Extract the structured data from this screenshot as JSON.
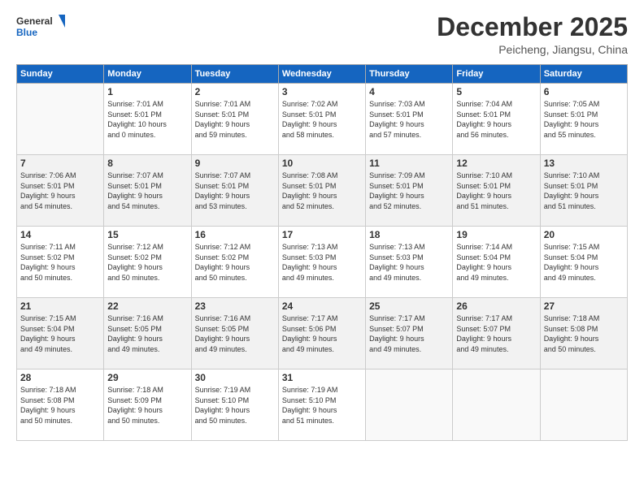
{
  "logo": {
    "line1": "General",
    "line2": "Blue"
  },
  "title": "December 2025",
  "subtitle": "Peicheng, Jiangsu, China",
  "weekdays": [
    "Sunday",
    "Monday",
    "Tuesday",
    "Wednesday",
    "Thursday",
    "Friday",
    "Saturday"
  ],
  "weeks": [
    [
      {
        "day": "",
        "content": ""
      },
      {
        "day": "1",
        "content": "Sunrise: 7:01 AM\nSunset: 5:01 PM\nDaylight: 10 hours\nand 0 minutes."
      },
      {
        "day": "2",
        "content": "Sunrise: 7:01 AM\nSunset: 5:01 PM\nDaylight: 9 hours\nand 59 minutes."
      },
      {
        "day": "3",
        "content": "Sunrise: 7:02 AM\nSunset: 5:01 PM\nDaylight: 9 hours\nand 58 minutes."
      },
      {
        "day": "4",
        "content": "Sunrise: 7:03 AM\nSunset: 5:01 PM\nDaylight: 9 hours\nand 57 minutes."
      },
      {
        "day": "5",
        "content": "Sunrise: 7:04 AM\nSunset: 5:01 PM\nDaylight: 9 hours\nand 56 minutes."
      },
      {
        "day": "6",
        "content": "Sunrise: 7:05 AM\nSunset: 5:01 PM\nDaylight: 9 hours\nand 55 minutes."
      }
    ],
    [
      {
        "day": "7",
        "content": "Sunrise: 7:06 AM\nSunset: 5:01 PM\nDaylight: 9 hours\nand 54 minutes."
      },
      {
        "day": "8",
        "content": "Sunrise: 7:07 AM\nSunset: 5:01 PM\nDaylight: 9 hours\nand 54 minutes."
      },
      {
        "day": "9",
        "content": "Sunrise: 7:07 AM\nSunset: 5:01 PM\nDaylight: 9 hours\nand 53 minutes."
      },
      {
        "day": "10",
        "content": "Sunrise: 7:08 AM\nSunset: 5:01 PM\nDaylight: 9 hours\nand 52 minutes."
      },
      {
        "day": "11",
        "content": "Sunrise: 7:09 AM\nSunset: 5:01 PM\nDaylight: 9 hours\nand 52 minutes."
      },
      {
        "day": "12",
        "content": "Sunrise: 7:10 AM\nSunset: 5:01 PM\nDaylight: 9 hours\nand 51 minutes."
      },
      {
        "day": "13",
        "content": "Sunrise: 7:10 AM\nSunset: 5:01 PM\nDaylight: 9 hours\nand 51 minutes."
      }
    ],
    [
      {
        "day": "14",
        "content": "Sunrise: 7:11 AM\nSunset: 5:02 PM\nDaylight: 9 hours\nand 50 minutes."
      },
      {
        "day": "15",
        "content": "Sunrise: 7:12 AM\nSunset: 5:02 PM\nDaylight: 9 hours\nand 50 minutes."
      },
      {
        "day": "16",
        "content": "Sunrise: 7:12 AM\nSunset: 5:02 PM\nDaylight: 9 hours\nand 50 minutes."
      },
      {
        "day": "17",
        "content": "Sunrise: 7:13 AM\nSunset: 5:03 PM\nDaylight: 9 hours\nand 49 minutes."
      },
      {
        "day": "18",
        "content": "Sunrise: 7:13 AM\nSunset: 5:03 PM\nDaylight: 9 hours\nand 49 minutes."
      },
      {
        "day": "19",
        "content": "Sunrise: 7:14 AM\nSunset: 5:04 PM\nDaylight: 9 hours\nand 49 minutes."
      },
      {
        "day": "20",
        "content": "Sunrise: 7:15 AM\nSunset: 5:04 PM\nDaylight: 9 hours\nand 49 minutes."
      }
    ],
    [
      {
        "day": "21",
        "content": "Sunrise: 7:15 AM\nSunset: 5:04 PM\nDaylight: 9 hours\nand 49 minutes."
      },
      {
        "day": "22",
        "content": "Sunrise: 7:16 AM\nSunset: 5:05 PM\nDaylight: 9 hours\nand 49 minutes."
      },
      {
        "day": "23",
        "content": "Sunrise: 7:16 AM\nSunset: 5:05 PM\nDaylight: 9 hours\nand 49 minutes."
      },
      {
        "day": "24",
        "content": "Sunrise: 7:17 AM\nSunset: 5:06 PM\nDaylight: 9 hours\nand 49 minutes."
      },
      {
        "day": "25",
        "content": "Sunrise: 7:17 AM\nSunset: 5:07 PM\nDaylight: 9 hours\nand 49 minutes."
      },
      {
        "day": "26",
        "content": "Sunrise: 7:17 AM\nSunset: 5:07 PM\nDaylight: 9 hours\nand 49 minutes."
      },
      {
        "day": "27",
        "content": "Sunrise: 7:18 AM\nSunset: 5:08 PM\nDaylight: 9 hours\nand 50 minutes."
      }
    ],
    [
      {
        "day": "28",
        "content": "Sunrise: 7:18 AM\nSunset: 5:08 PM\nDaylight: 9 hours\nand 50 minutes."
      },
      {
        "day": "29",
        "content": "Sunrise: 7:18 AM\nSunset: 5:09 PM\nDaylight: 9 hours\nand 50 minutes."
      },
      {
        "day": "30",
        "content": "Sunrise: 7:19 AM\nSunset: 5:10 PM\nDaylight: 9 hours\nand 50 minutes."
      },
      {
        "day": "31",
        "content": "Sunrise: 7:19 AM\nSunset: 5:10 PM\nDaylight: 9 hours\nand 51 minutes."
      },
      {
        "day": "",
        "content": ""
      },
      {
        "day": "",
        "content": ""
      },
      {
        "day": "",
        "content": ""
      }
    ]
  ]
}
